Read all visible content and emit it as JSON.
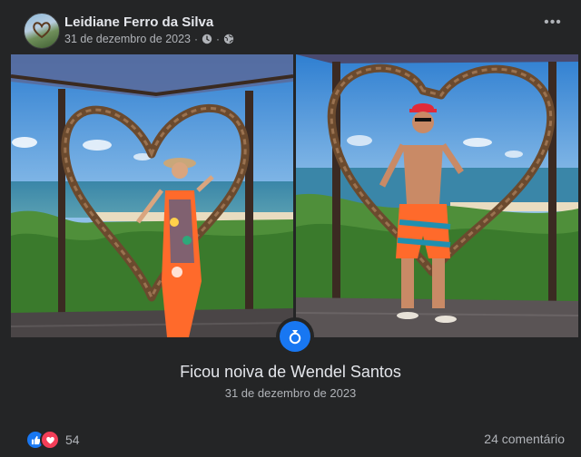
{
  "post": {
    "author": "Leidiane Ferro da Silva",
    "date": "31 de dezembro de 2023",
    "meta_separator": "·",
    "more_label": "•••"
  },
  "icons": {
    "avatar": "avatar-photo",
    "clock": "clock-icon",
    "globe": "globe-icon",
    "more": "more-options-icon",
    "ring": "ring-icon",
    "like": "like-icon",
    "love": "love-icon"
  },
  "event": {
    "title": "Ficou noiva de Wendel Santos",
    "date": "31 de dezembro de 2023"
  },
  "footer": {
    "reaction_count": "54",
    "comments": "24 comentário"
  },
  "colors": {
    "background": "#242526",
    "accent": "#1877f2",
    "love": "#f33e58",
    "text_primary": "#e4e6eb",
    "text_secondary": "#b0b3b8"
  }
}
